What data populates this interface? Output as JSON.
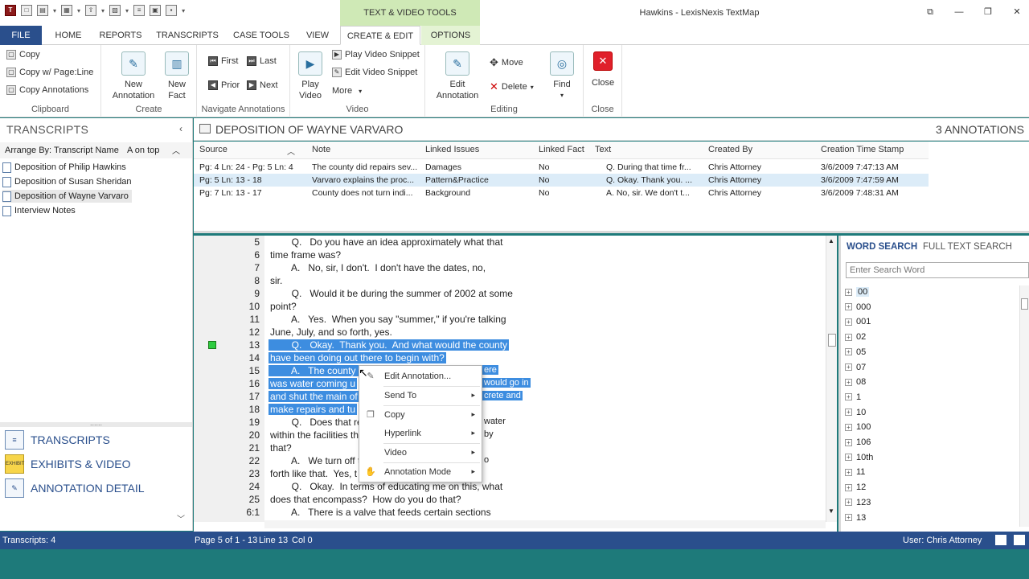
{
  "window": {
    "title": "Hawkins - LexisNexis TextMap",
    "context_tab_group": "TEXT & VIDEO TOOLS"
  },
  "tabs": [
    "FILE",
    "HOME",
    "REPORTS",
    "TRANSCRIPTS",
    "CASE TOOLS",
    "VIEW",
    "CREATE & EDIT",
    "OPTIONS"
  ],
  "ribbon": {
    "clipboard": {
      "label": "Clipboard",
      "copy": "Copy",
      "copy_page_line": "Copy w/ Page:Line",
      "copy_annotations": "Copy Annotations"
    },
    "create": {
      "label": "Create",
      "new_annotation": [
        "New",
        "Annotation"
      ],
      "new_fact": [
        "New",
        "Fact"
      ]
    },
    "navigate": {
      "label": "Navigate Annotations",
      "first": "First",
      "last": "Last",
      "prior": "Prior",
      "next": "Next"
    },
    "video": {
      "label": "Video",
      "play_video": [
        "Play",
        "Video"
      ],
      "play_snippet": "Play Video Snippet",
      "edit_snippet": "Edit Video Snippet",
      "more": "More"
    },
    "editing": {
      "label": "Editing",
      "edit_annotation": [
        "Edit",
        "Annotation"
      ],
      "move": "Move",
      "delete": "Delete",
      "find": "Find"
    },
    "close": {
      "label": "Close",
      "close": "Close"
    }
  },
  "left_panel": {
    "header": "TRANSCRIPTS",
    "arrange_label": "Arrange By: Transcript Name",
    "sort_label": "A on top",
    "items": [
      "Deposition of Philip Hawkins",
      "Deposition of Susan Sheridan",
      "Deposition of Wayne Varvaro",
      "Interview Notes"
    ],
    "grip": "......",
    "nav": [
      "TRANSCRIPTS",
      "EXHIBITS & VIDEO",
      "ANNOTATION DETAIL"
    ],
    "exhibit_icon_text": "EXHIBIT"
  },
  "doc": {
    "title": "DEPOSITION OF WAYNE VARVARO",
    "count": "3 ANNOTATIONS"
  },
  "grid": {
    "columns": [
      "Source",
      "Note",
      "Linked Issues",
      "Linked Fact",
      "Text",
      "Created By",
      "Creation Time Stamp"
    ],
    "rows": [
      [
        "Pg: 4 Ln: 24 - Pg: 5 Ln: 4",
        "The county did repairs sev...",
        "Damages",
        "No",
        "Q.   During that time fr...",
        "Chris Attorney",
        "3/6/2009 7:47:13 AM"
      ],
      [
        "Pg: 5 Ln: 13 - 18",
        "Varvaro explains the proc...",
        "Pattern&Practice",
        "No",
        "Q.   Okay.  Thank you. ...",
        "Chris Attorney",
        "3/6/2009 7:47:59 AM"
      ],
      [
        "Pg: 7 Ln: 13 - 17",
        "County does not turn indi...",
        "Background",
        "No",
        "A.   No, sir.  We don't t...",
        "Chris Attorney",
        "3/6/2009 7:48:31 AM"
      ]
    ]
  },
  "transcript": {
    "lines": [
      {
        "n": "5",
        "t": "        Q.   Do you have an idea approximately what that"
      },
      {
        "n": "6",
        "t": "time frame was?"
      },
      {
        "n": "7",
        "t": "        A.   No, sir, I don't.  I don't have the dates, no,"
      },
      {
        "n": "8",
        "t": "sir."
      },
      {
        "n": "9",
        "t": "        Q.   Would it be during the summer of 2002 at some"
      },
      {
        "n": "10",
        "t": "point?"
      },
      {
        "n": "11",
        "t": "        A.   Yes.  When you say \"summer,\" if you're talking"
      },
      {
        "n": "12",
        "t": "June, July, and so forth, yes."
      },
      {
        "n": "13",
        "t": "        Q.   Okay.  Thank you.  And what would the county"
      },
      {
        "n": "14",
        "t": "have been doing out there to begin with?"
      },
      {
        "n": "15",
        "t": "        A.   The county w"
      },
      {
        "n": "16",
        "t": "was water coming u"
      },
      {
        "n": "17",
        "t": "and shut the main of"
      },
      {
        "n": "18",
        "t": "make repairs and tu"
      },
      {
        "n": "19",
        "t": "        Q.   Does that re"
      },
      {
        "n": "20",
        "t": "within the facilities th"
      },
      {
        "n": "21",
        "t": "that?"
      },
      {
        "n": "22",
        "t": "        A.   We turn off t"
      },
      {
        "n": "23",
        "t": "forth like that.  Yes, t"
      },
      {
        "n": "24",
        "t": "        Q.   Okay.  In terms of educating me on this, what"
      },
      {
        "n": "25",
        "t": "does that encompass?  How do you do that?"
      },
      {
        "n": "6:1",
        "t": "        A.   There is a valve that feeds certain sections"
      }
    ],
    "fragments_right": [
      {
        "line": 15,
        "t": "ere"
      },
      {
        "line": 16,
        "t": "would go in"
      },
      {
        "line": 17,
        "t": "crete and"
      },
      {
        "line": 19,
        "t": "water"
      },
      {
        "line": 20,
        "t": "by"
      },
      {
        "line": 22,
        "t": "o"
      }
    ]
  },
  "context_menu": {
    "items": [
      "Edit Annotation...",
      "Send To",
      "Copy",
      "Hyperlink",
      "Video",
      "Annotation Mode"
    ],
    "arrow": "▸"
  },
  "search": {
    "tabs": [
      "WORD SEARCH",
      "FULL TEXT SEARCH"
    ],
    "placeholder": "Enter Search Word",
    "words": [
      "00",
      "000",
      "001",
      "02",
      "05",
      "07",
      "08",
      "1",
      "10",
      "100",
      "106",
      "10th",
      "11",
      "12",
      "123",
      "13"
    ]
  },
  "status": {
    "transcripts": "Transcripts: 4",
    "page": "Page 5 of 1 - 13",
    "line": "Line 13",
    "col": "Col 0",
    "user": "User: Chris Attorney"
  },
  "colors": {
    "accent": "#2a4f8c",
    "highlight": "#3d8de0",
    "context_tab": "#cfe9b6",
    "marker": "#2ecc40",
    "close_red": "#e0202b"
  }
}
